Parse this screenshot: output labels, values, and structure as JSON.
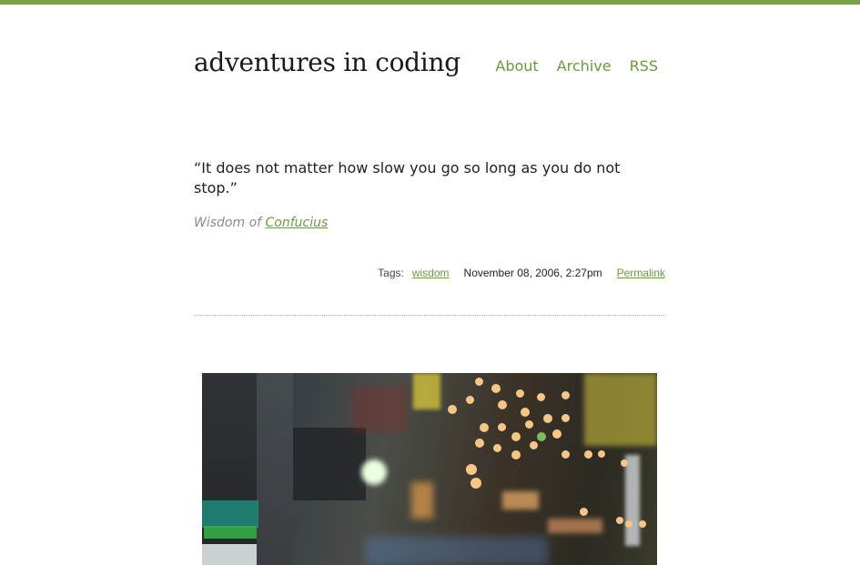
{
  "header": {
    "site_title": "adventures in coding",
    "nav": [
      {
        "label": "About"
      },
      {
        "label": "Archive"
      },
      {
        "label": "RSS"
      }
    ]
  },
  "post": {
    "quote": "“It does not matter how slow you go so long as you do not stop.”",
    "attribution_prefix": "Wisdom of",
    "attribution_name": "Confucius",
    "meta": {
      "tags_label": "Tags:",
      "tag": "wisdom",
      "date": "November 08, 2006, 2:27pm",
      "permalink_label": "Permalink"
    }
  },
  "colors": {
    "accent": "#7ba04a",
    "link": "#6a9a3d",
    "muted": "#8a8a8a"
  }
}
